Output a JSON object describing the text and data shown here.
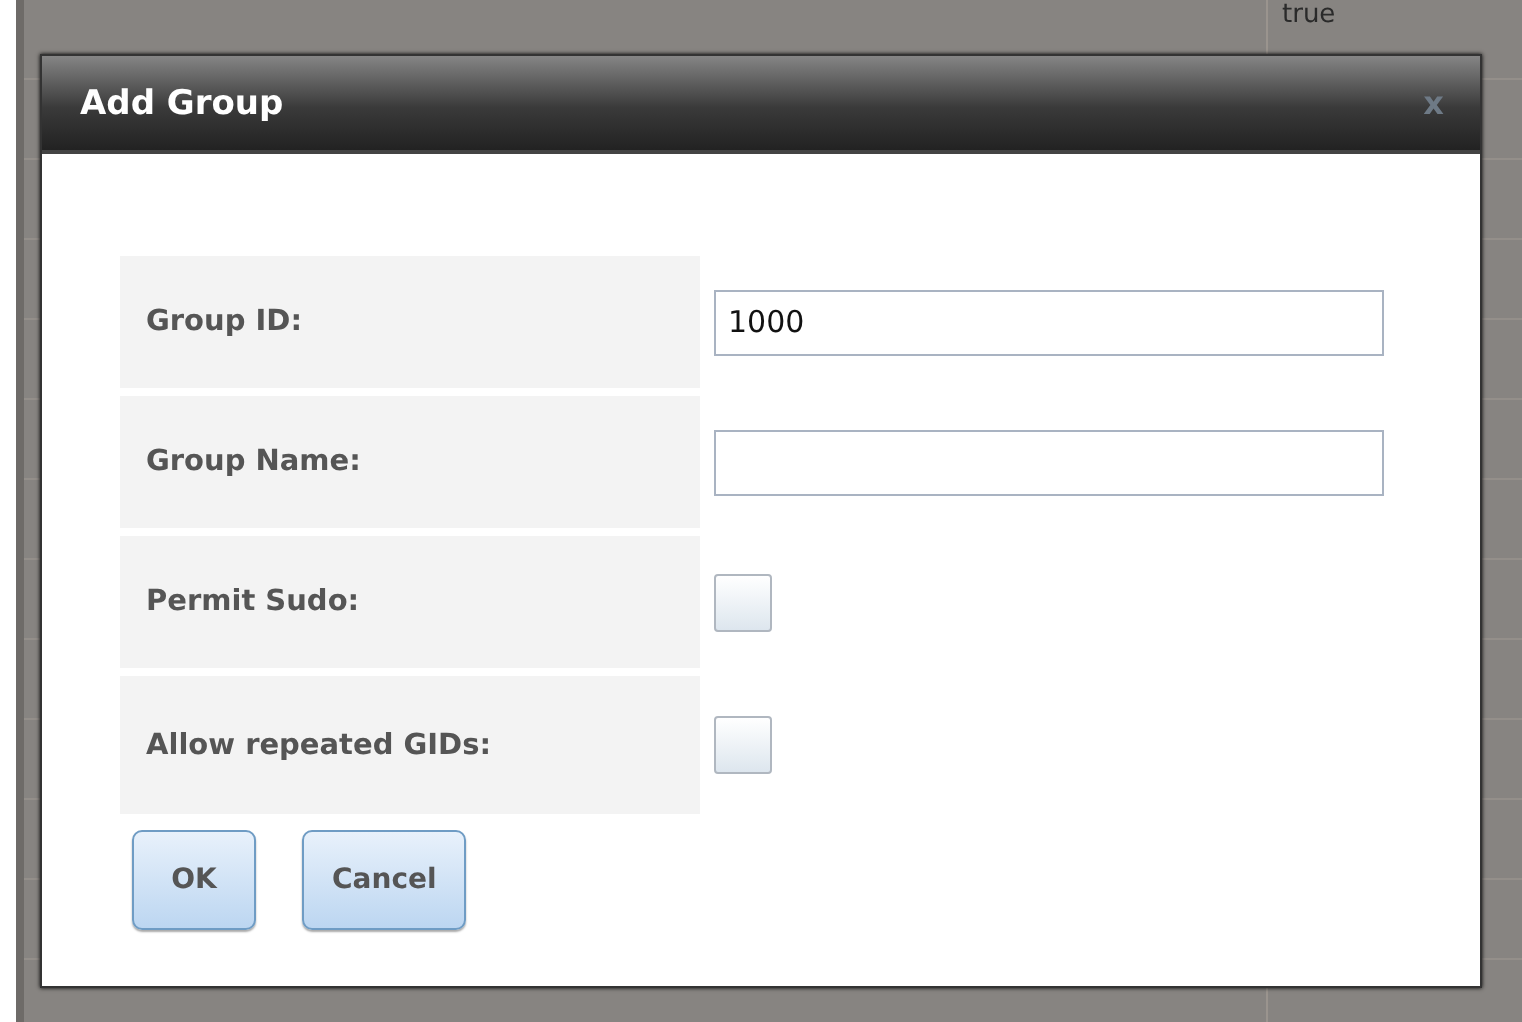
{
  "background": {
    "cell_text": "true"
  },
  "dialog": {
    "title": "Add Group",
    "close": "x",
    "fields": [
      {
        "kind": "text",
        "label": "Group ID:",
        "value": "1000"
      },
      {
        "kind": "text",
        "label": "Group Name:"
      },
      {
        "kind": "checkbox",
        "label": "Permit Sudo:",
        "checked": false
      },
      {
        "kind": "checkbox",
        "label": "Allow repeated GIDs:",
        "checked": false
      }
    ],
    "buttons": [
      "OK",
      "Cancel"
    ]
  }
}
